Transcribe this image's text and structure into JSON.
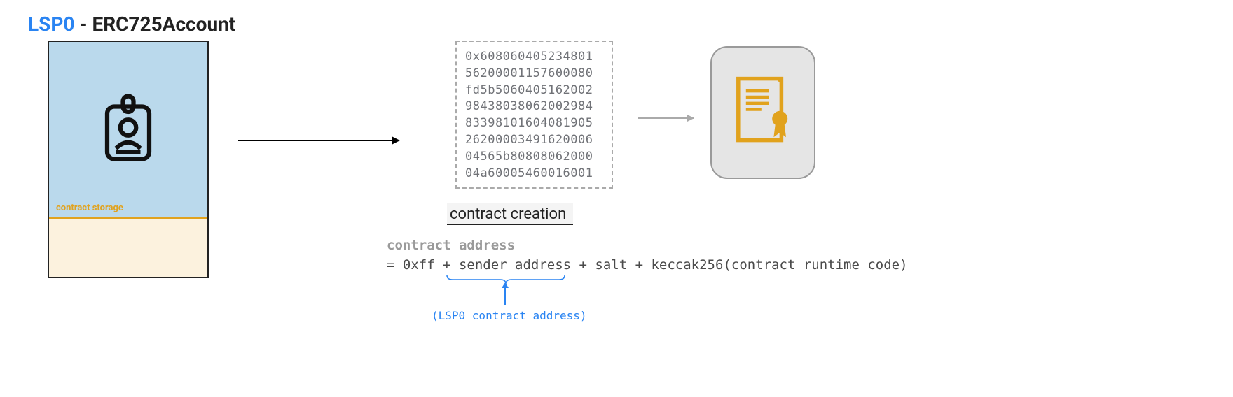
{
  "title": {
    "lsp0": "LSP0",
    "erc": " - ERC725Account"
  },
  "card": {
    "storage_label": "contract storage"
  },
  "bytecode": {
    "l0": "0x608060405234801",
    "l1": "56200001157600080",
    "l2": "fd5b5060405162002",
    "l3": "98438038062002984",
    "l4": "83398101604081905",
    "l5": "26200003491620006",
    "l6": "04565b80808062000",
    "l7": "04a60005460016001"
  },
  "creation_label": "contract creation",
  "formula": {
    "label": "contract address",
    "expr": "= 0xff + sender address + salt + keccak256(contract runtime code)"
  },
  "note": "(LSP0 contract address)"
}
